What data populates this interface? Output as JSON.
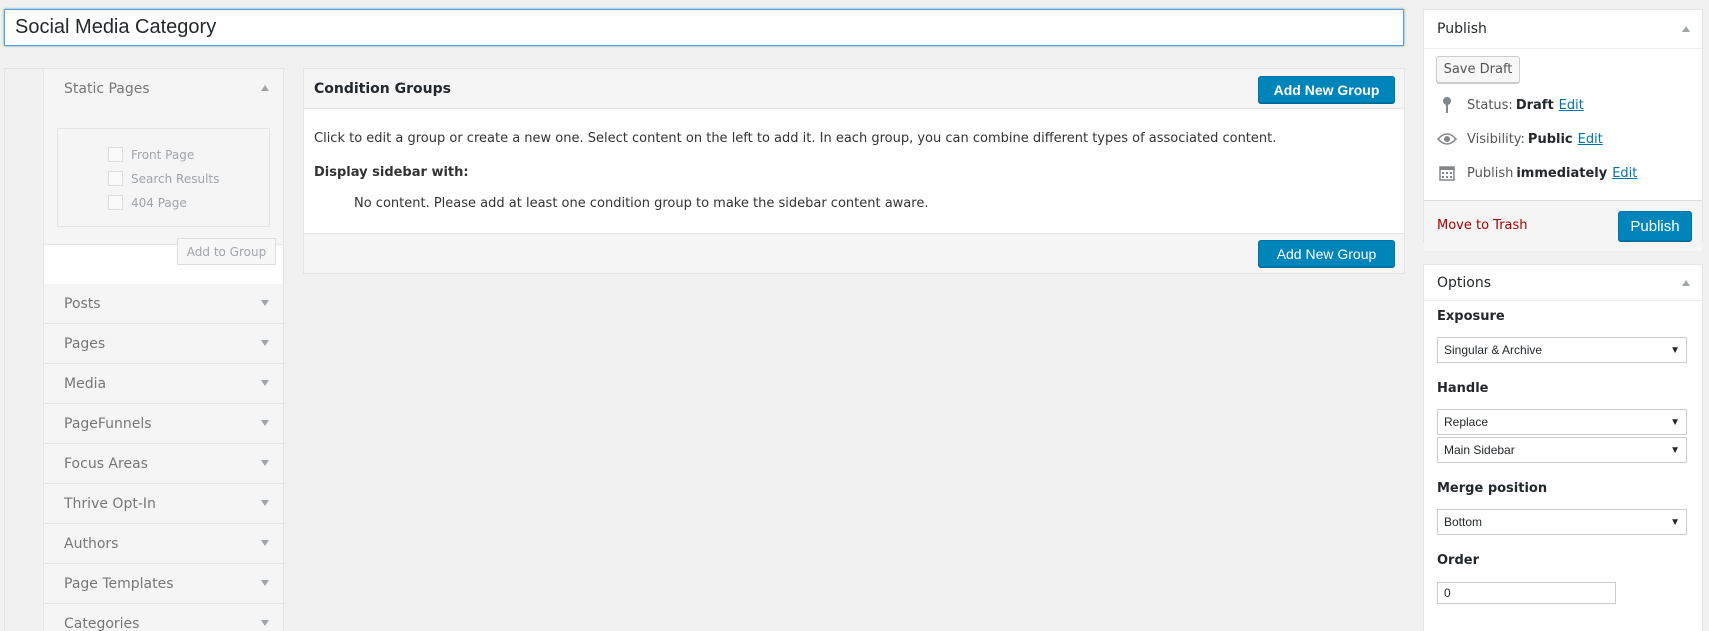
{
  "title": {
    "value": "Social Media Category"
  },
  "left": {
    "static_pages": {
      "heading": "Static Pages",
      "options": [
        "Front Page",
        "Search Results",
        "404 Page"
      ],
      "add_button": "Add to Group"
    },
    "sections": [
      "Posts",
      "Pages",
      "Media",
      "PageFunnels",
      "Focus Areas",
      "Thrive Opt-In",
      "Authors",
      "Page Templates",
      "Categories"
    ]
  },
  "conditions": {
    "heading": "Condition Groups",
    "add_button": "Add New Group",
    "help_text": "Click to edit a group or create a new one. Select content on the left to add it. In each group, you can combine different types of associated content.",
    "display_label": "Display sidebar with:",
    "empty_text": "No content. Please add at least one condition group to make the sidebar content aware."
  },
  "publish": {
    "heading": "Publish",
    "save_draft": "Save Draft",
    "status_label": "Status:",
    "status_value": "Draft",
    "visibility_label": "Visibility:",
    "visibility_value": "Public",
    "publish_label": "Publish",
    "publish_value": "immediately",
    "edit_label": "Edit",
    "trash": "Move to Trash",
    "publish_button": "Publish",
    "icons": [
      "pin-icon",
      "eye-icon",
      "calendar-icon"
    ]
  },
  "options": {
    "heading": "Options",
    "exposure_label": "Exposure",
    "exposure_value": "Singular & Archive",
    "handle_label": "Handle",
    "handle_value": "Replace",
    "sidebar_value": "Main Sidebar",
    "merge_label": "Merge position",
    "merge_value": "Bottom",
    "order_label": "Order",
    "order_value": "0"
  },
  "colors": {
    "primary": "#0085ba",
    "link": "#0073aa",
    "trash": "#a00000"
  }
}
